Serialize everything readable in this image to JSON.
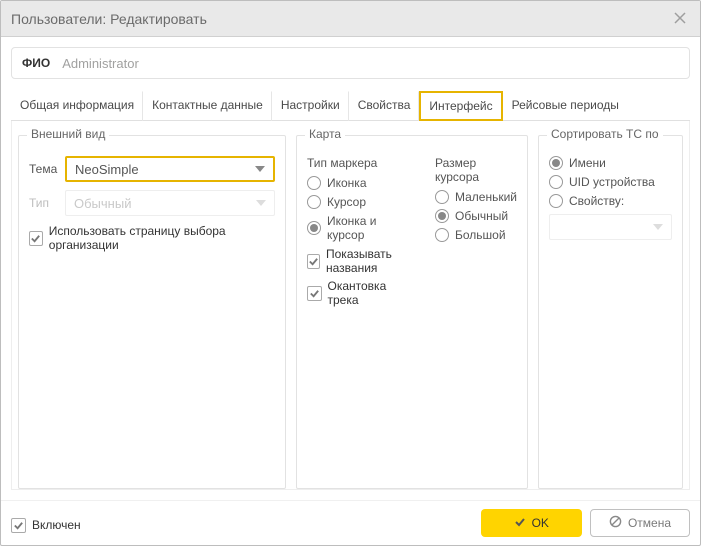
{
  "window": {
    "title": "Пользователи: Редактировать"
  },
  "fio": {
    "label": "ФИО",
    "value": "Administrator"
  },
  "tabs": {
    "general": "Общая информация",
    "contact": "Контактные данные",
    "settings": "Настройки",
    "properties": "Свойства",
    "interface": "Интерфейс",
    "periods": "Рейсовые периоды"
  },
  "appearance": {
    "legend": "Внешний вид",
    "theme_label": "Тема",
    "theme_value": "NeoSimple",
    "type_label": "Тип",
    "type_value": "Обычный",
    "org_checkbox": "Использовать страницу выбора организации"
  },
  "map": {
    "legend": "Карта",
    "marker_heading": "Тип маркера",
    "cursor_heading": "Размер курсора",
    "marker_options": {
      "icon": "Иконка",
      "cursor": "Курсор",
      "icon_cursor": "Иконка и курсор"
    },
    "show_names": "Показывать названия",
    "track_outline": "Окантовка трека",
    "cursor_options": {
      "small": "Маленький",
      "normal": "Обычный",
      "large": "Большой"
    }
  },
  "sort": {
    "legend": "Сортировать ТС по",
    "options": {
      "name": "Имени",
      "uid": "UID устройства",
      "property": "Свойству:"
    }
  },
  "footer": {
    "enabled": "Включен",
    "ok": "OK",
    "cancel": "Отмена"
  }
}
